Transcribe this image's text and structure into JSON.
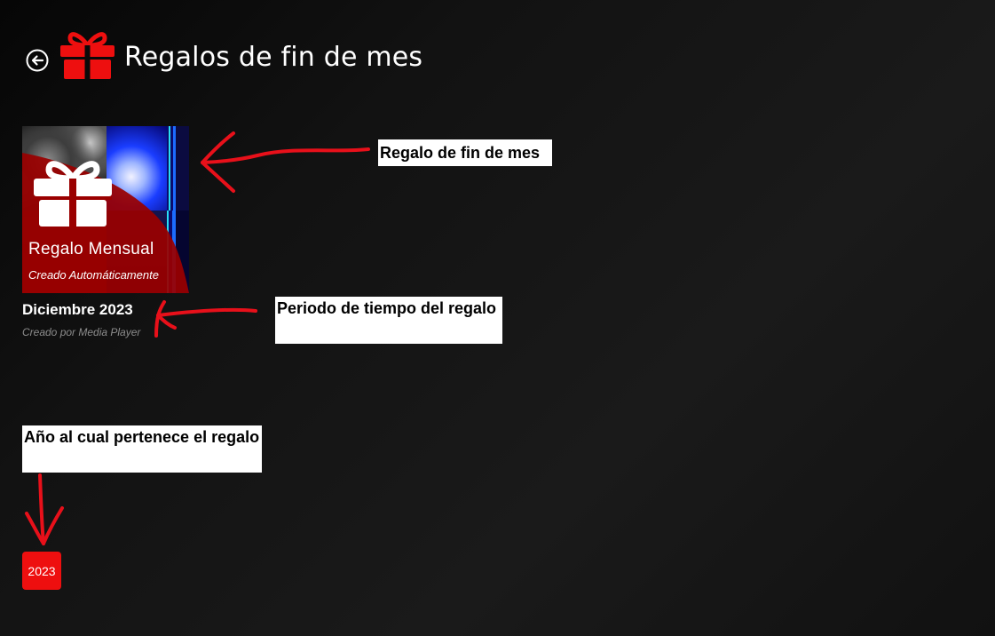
{
  "header": {
    "back_icon": "back-arrow-icon",
    "gift_icon": "gift-icon",
    "title": "Regalos de fin de mes"
  },
  "gift_card": {
    "title": "Regalo Mensual",
    "subtitle": "Creado Automáticamente",
    "period": "Diciembre 2023",
    "creator": "Creado por Media Player"
  },
  "annotations": {
    "gift_note": "Regalo de fin de mes",
    "period_note": "Periodo de tiempo del regalo",
    "year_note": "Año al cual pertenece el regalo"
  },
  "year_filter": {
    "label": "2023"
  },
  "colors": {
    "accent": "#ee0f0f",
    "overlay": "#9a0000",
    "annotation_arrow": "#e8101a"
  }
}
